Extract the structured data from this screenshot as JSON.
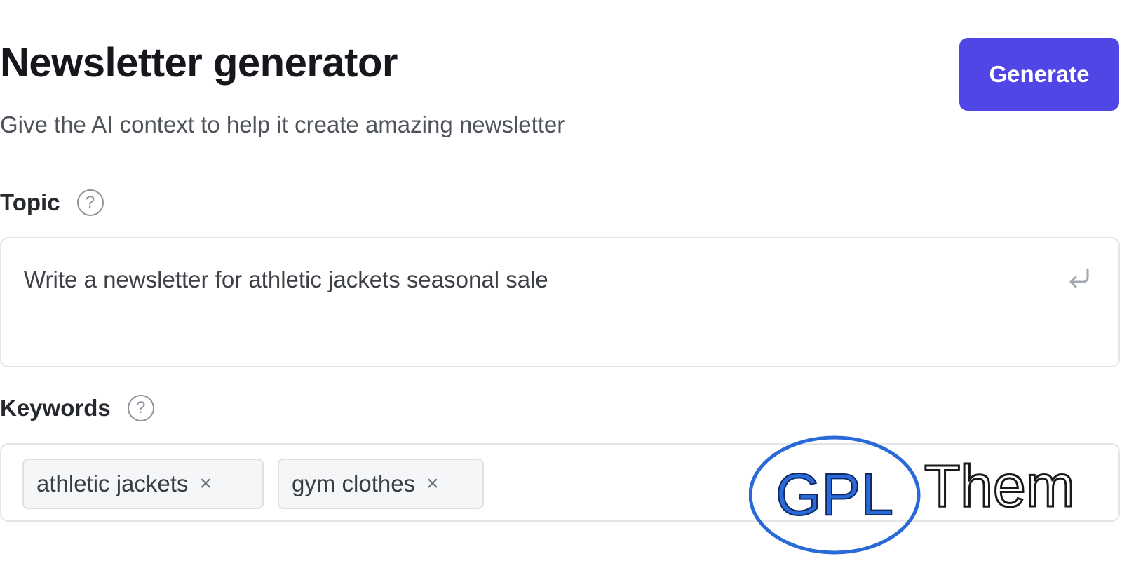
{
  "header": {
    "title": "Newsletter generator",
    "subtitle": "Give the AI context to help it create amazing newsletter",
    "generate_label": "Generate"
  },
  "topic": {
    "label": "Topic",
    "help_glyph": "?",
    "value": "Write a newsletter for athletic jackets seasonal sale",
    "enter_icon": "enter-return-icon"
  },
  "keywords": {
    "label": "Keywords",
    "help_glyph": "?",
    "chips": [
      {
        "label": "athletic jackets",
        "close": "×"
      },
      {
        "label": "gym clothes",
        "close": "×"
      }
    ]
  },
  "watermark": {
    "logo_text": "GPL",
    "text": "Them"
  },
  "colors": {
    "accent": "#4f46e5",
    "watermark_blue": "#2a6ad8",
    "border": "#e3e5e8"
  }
}
